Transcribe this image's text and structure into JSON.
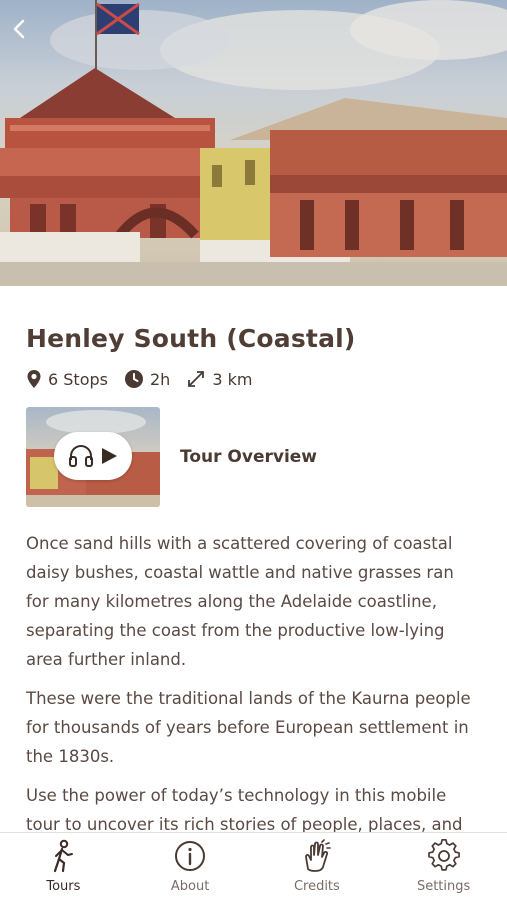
{
  "tour": {
    "title": "Henley South (Coastal)",
    "stops": "6 Stops",
    "duration": "2h",
    "distance": "3 km"
  },
  "overview": {
    "label": "Tour Overview"
  },
  "description": [
    "Once sand hills with a scattered covering of coastal daisy bushes, coastal wattle and native grasses ran for many kilometres along the Adelaide coastline, separating the coast from the productive low-lying area further inland.",
    "These were the traditional lands of the Kaurna people for thousands of years before European settlement in the 1830s.",
    "Use the power of today’s technology in this mobile tour to uncover its rich stories of people, places, and"
  ],
  "tabs": [
    {
      "label": "Tours",
      "icon": "hiker-icon",
      "active": true
    },
    {
      "label": "About",
      "icon": "info-icon",
      "active": false
    },
    {
      "label": "Credits",
      "icon": "clapping-hands-icon",
      "active": false
    },
    {
      "label": "Settings",
      "icon": "gear-icon",
      "active": false
    }
  ],
  "colors": {
    "text": "#4a3a33",
    "accent": "#503e36",
    "background": "#ffffff"
  }
}
